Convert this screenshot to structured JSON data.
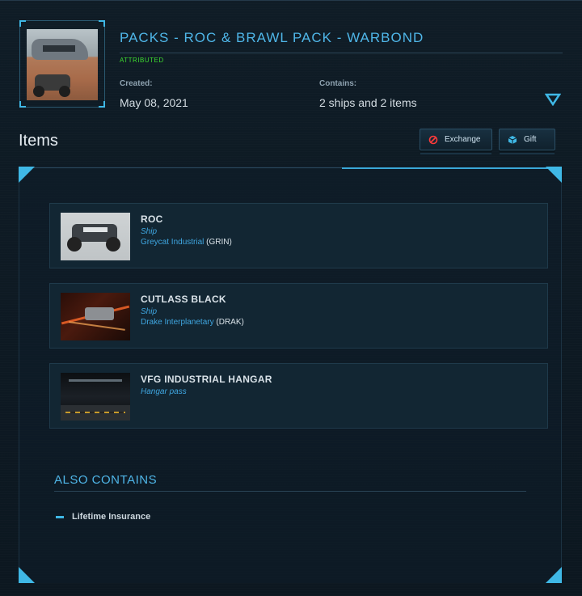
{
  "pack": {
    "title": "PACKS - ROC & BRAWL PACK - WARBOND",
    "status": "ATTRIBUTED",
    "created_label": "Created:",
    "created_value": "May 08, 2021",
    "contains_label": "Contains:",
    "contains_value": "2 ships and 2 items"
  },
  "items_section": {
    "heading": "Items",
    "exchange_label": "Exchange",
    "gift_label": "Gift"
  },
  "items": [
    {
      "name": "ROC",
      "type": "Ship",
      "maker": "Greycat Industrial",
      "maker_code": "(GRIN)"
    },
    {
      "name": "CUTLASS BLACK",
      "type": "Ship",
      "maker": "Drake Interplanetary",
      "maker_code": "(DRAK)"
    },
    {
      "name": "VFG INDUSTRIAL HANGAR",
      "type": "Hangar pass",
      "maker": "",
      "maker_code": ""
    }
  ],
  "also_contains": {
    "heading": "ALSO CONTAINS",
    "items": [
      "Lifetime Insurance"
    ]
  },
  "colors": {
    "accent": "#3fb8e6",
    "title": "#4fb6e8",
    "attributed": "#3ddc2f",
    "background": "#0e1a23"
  },
  "icons": {
    "expand": "chevron-down-icon",
    "exchange": "no-entry-icon",
    "gift": "cube-icon"
  }
}
